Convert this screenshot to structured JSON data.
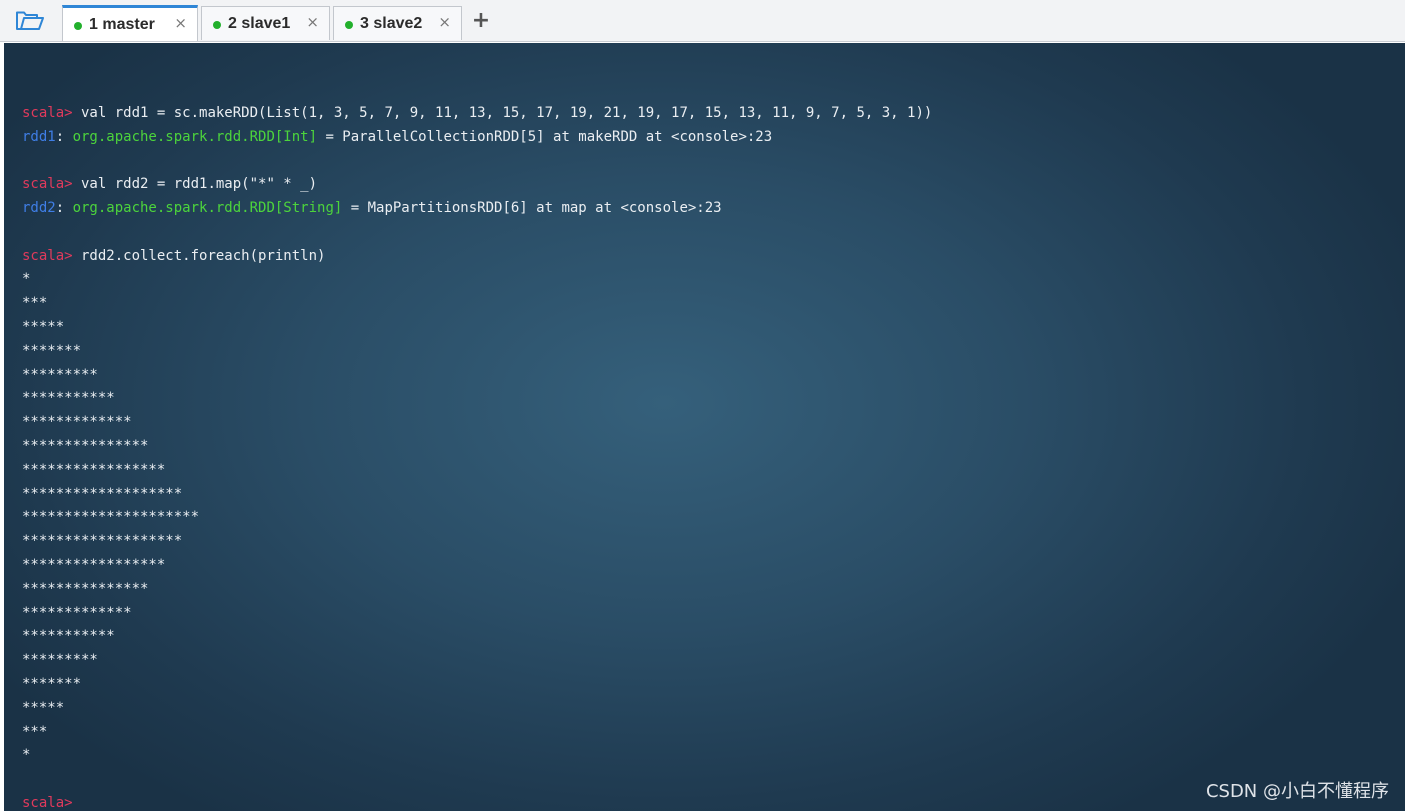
{
  "tabs": [
    {
      "label": "1 master",
      "active": true,
      "status_color": "#22b02c"
    },
    {
      "label": "2 slave1",
      "active": false,
      "status_color": "#22b02c"
    },
    {
      "label": "3 slave2",
      "active": false,
      "status_color": "#22b02c"
    }
  ],
  "icons": {
    "folder": "folder-open-icon",
    "close": "close-icon",
    "add": "plus-icon"
  },
  "tab_close_glyph": "×",
  "add_tab_glyph": "+",
  "terminal": {
    "colors": {
      "prompt": "#e03a5c",
      "identifier": "#3f7ee6",
      "type": "#4cd43c",
      "text": "#eaeef2"
    },
    "lines": [
      [],
      [
        {
          "t": "scala>",
          "c": "prompt"
        },
        {
          "t": " val rdd1 = sc.makeRDD(List(1, 3, 5, 7, 9, 11, 13, 15, 17, 19, 21, 19, 17, 15, 13, 11, 9, 7, 5, 3, 1))"
        }
      ],
      [
        {
          "t": "rdd1",
          "c": "ident"
        },
        {
          "t": ": "
        },
        {
          "t": "org.apache.spark.rdd.RDD[Int]",
          "c": "type"
        },
        {
          "t": " = ParallelCollectionRDD[5] at makeRDD at <console>:23"
        }
      ],
      [],
      [
        {
          "t": "scala>",
          "c": "prompt"
        },
        {
          "t": " val rdd2 = rdd1.map(\"*\" * _)"
        }
      ],
      [
        {
          "t": "rdd2",
          "c": "ident"
        },
        {
          "t": ": "
        },
        {
          "t": "org.apache.spark.rdd.RDD[String]",
          "c": "type"
        },
        {
          "t": " = MapPartitionsRDD[6] at map at <console>:23"
        }
      ],
      [],
      [
        {
          "t": "scala>",
          "c": "prompt"
        },
        {
          "t": " rdd2.collect.foreach(println)"
        }
      ],
      [
        {
          "t": "*"
        }
      ],
      [
        {
          "t": "***"
        }
      ],
      [
        {
          "t": "*****"
        }
      ],
      [
        {
          "t": "*******"
        }
      ],
      [
        {
          "t": "*********"
        }
      ],
      [
        {
          "t": "***********"
        }
      ],
      [
        {
          "t": "*************"
        }
      ],
      [
        {
          "t": "***************"
        }
      ],
      [
        {
          "t": "*****************"
        }
      ],
      [
        {
          "t": "*******************"
        }
      ],
      [
        {
          "t": "*********************"
        }
      ],
      [
        {
          "t": "*******************"
        }
      ],
      [
        {
          "t": "*****************"
        }
      ],
      [
        {
          "t": "***************"
        }
      ],
      [
        {
          "t": "*************"
        }
      ],
      [
        {
          "t": "***********"
        }
      ],
      [
        {
          "t": "*********"
        }
      ],
      [
        {
          "t": "*******"
        }
      ],
      [
        {
          "t": "*****"
        }
      ],
      [
        {
          "t": "***"
        }
      ],
      [
        {
          "t": "*"
        }
      ],
      [],
      [
        {
          "t": "scala>",
          "c": "prompt"
        }
      ]
    ]
  },
  "watermark": "CSDN @小白不懂程序"
}
